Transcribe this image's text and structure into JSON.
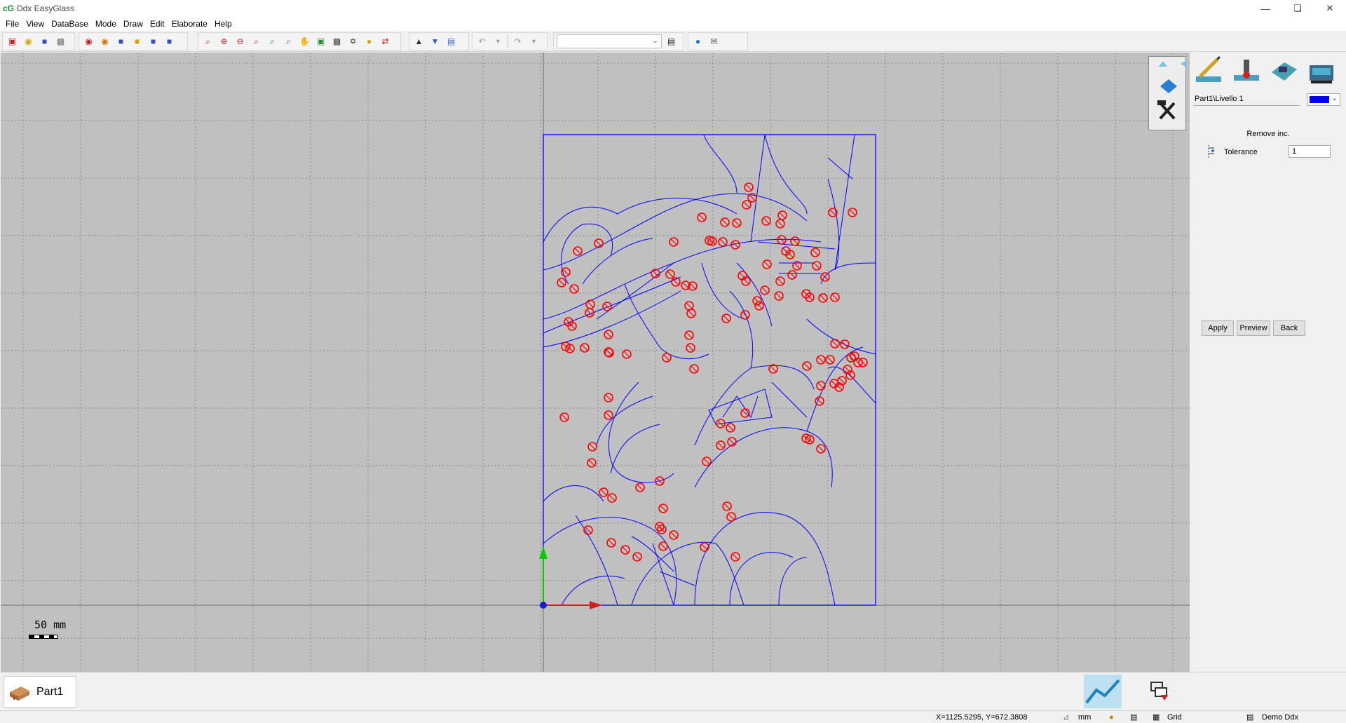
{
  "window": {
    "title": "Ddx EasyGlass",
    "logo": "cG"
  },
  "menu": [
    "File",
    "View",
    "DataBase",
    "Mode",
    "Draw",
    "Edit",
    "Elaborate",
    "Help"
  ],
  "canvas": {
    "scale_label": "50  mm"
  },
  "panel": {
    "layer": "Part1\\Livello 1",
    "layer_color": "#0000ff",
    "section_title": "Remove inc.",
    "tolerance_label": "Tolerance",
    "tolerance_value": "1",
    "apply": "Apply",
    "preview": "Preview",
    "back": "Back"
  },
  "part_tab": {
    "label": "Part1"
  },
  "status": {
    "coords": "X=1125.5295,  Y=672.3808",
    "unit": "mm",
    "grid": "Grid",
    "license": "Demo Ddx"
  },
  "colors": {
    "canvas_bg": "#c0c0c0",
    "drawing_lines": "#0000ff",
    "markers": "#ff0000"
  }
}
